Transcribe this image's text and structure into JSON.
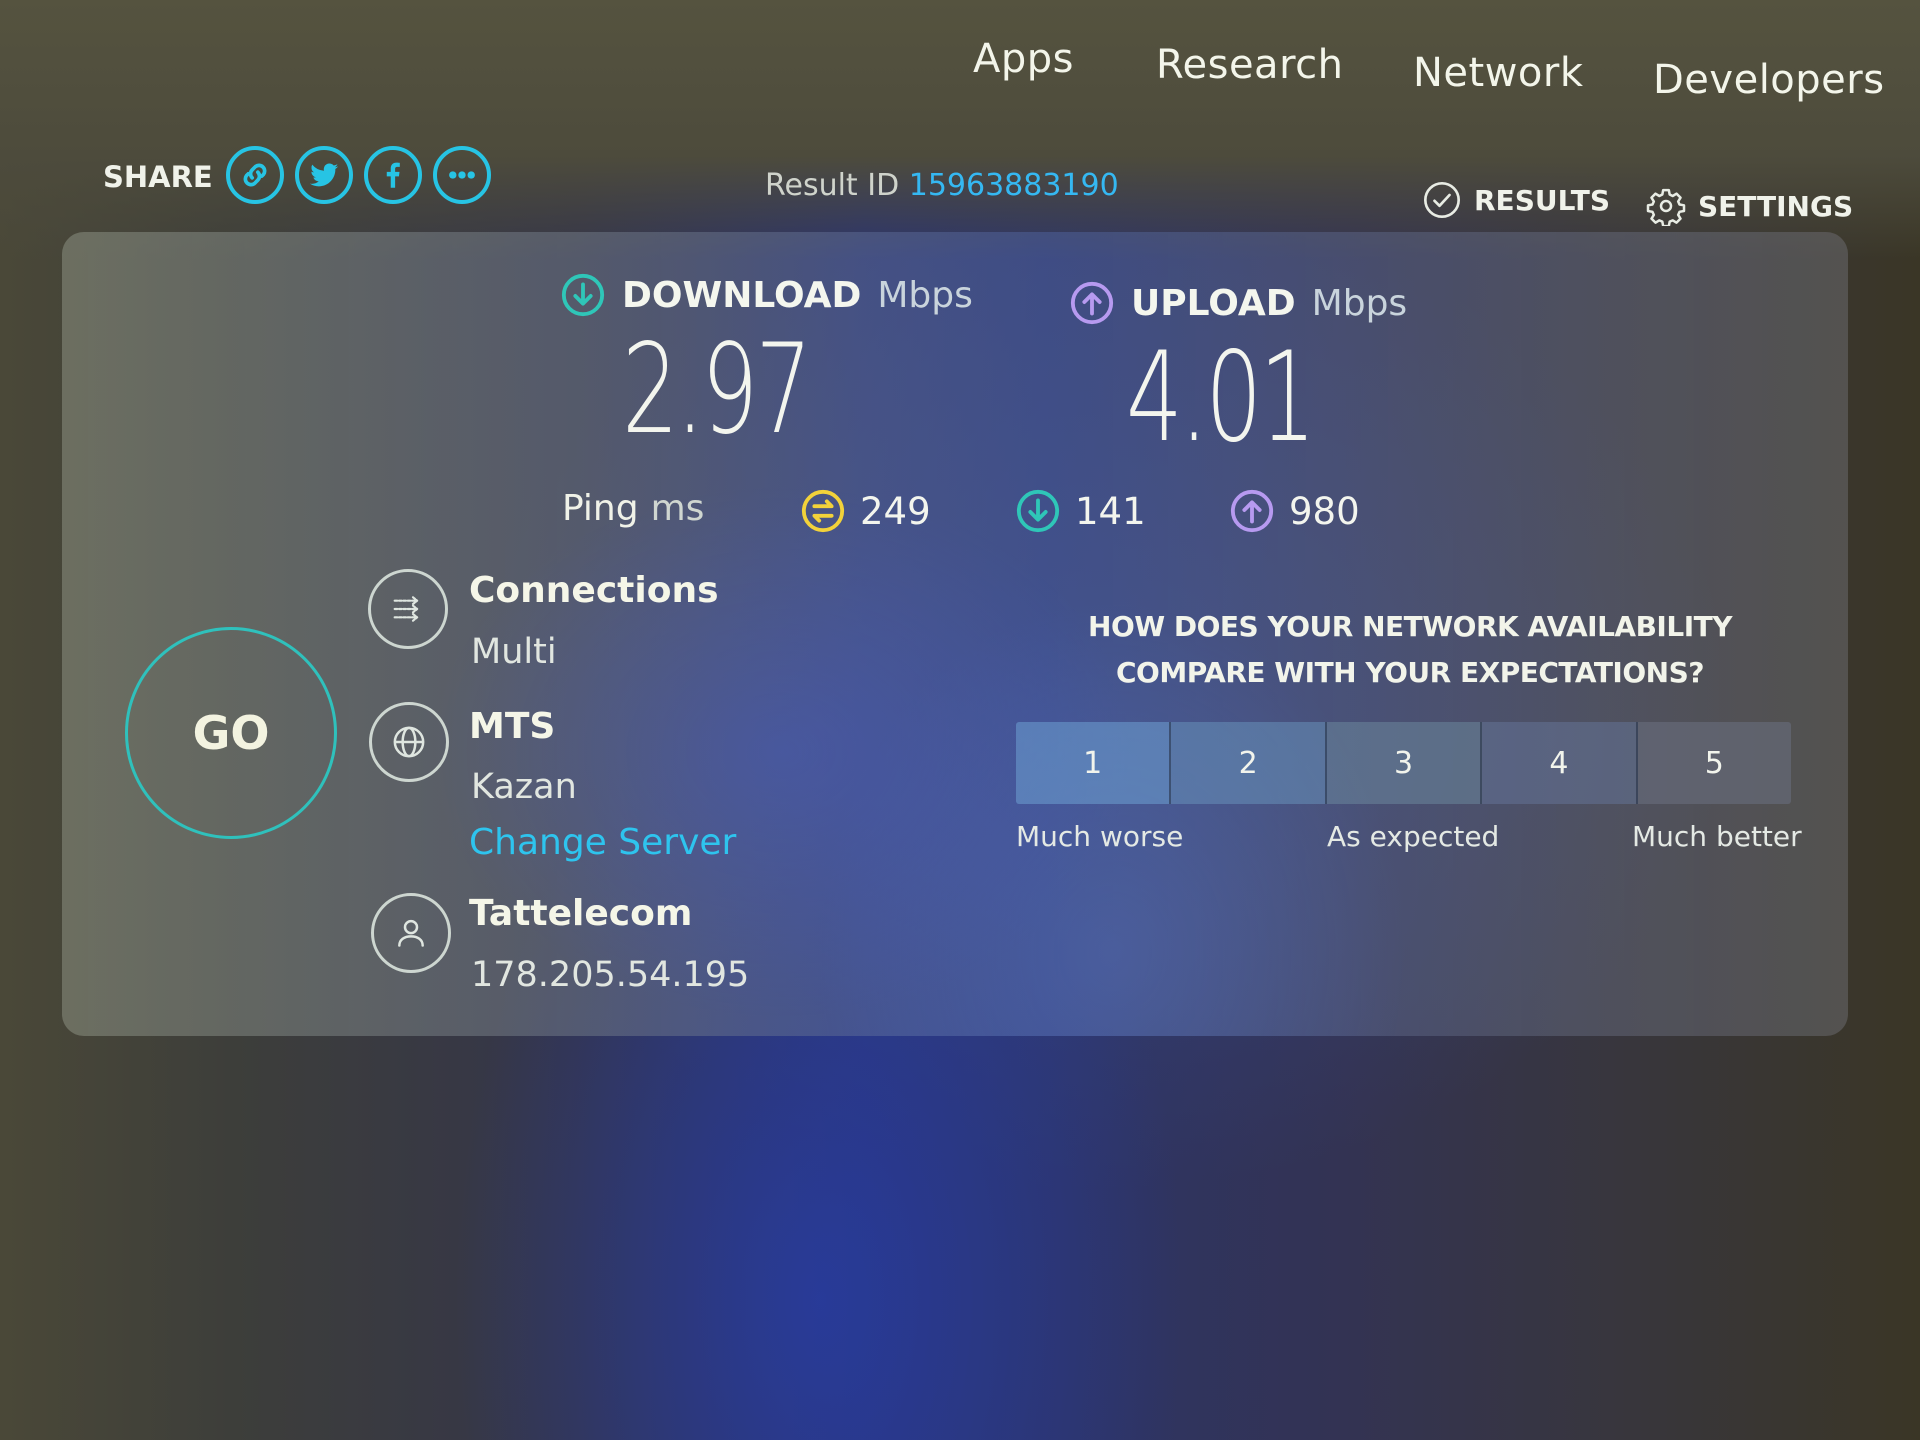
{
  "nav": {
    "items": [
      {
        "label": "Apps"
      },
      {
        "label": "Research"
      },
      {
        "label": "Network"
      },
      {
        "label": "Developers"
      }
    ]
  },
  "share": {
    "label": "SHARE",
    "buttons": [
      {
        "icon": "link-icon"
      },
      {
        "icon": "twitter-icon"
      },
      {
        "icon": "facebook-icon"
      },
      {
        "icon": "more-icon"
      }
    ]
  },
  "result": {
    "label": "Result ID",
    "id": "15963883190"
  },
  "header_actions": {
    "results_label": "RESULTS",
    "settings_label": "SETTINGS"
  },
  "download": {
    "label": "DOWNLOAD",
    "unit": "Mbps",
    "value": "2.97",
    "color": "#2fc6b8"
  },
  "upload": {
    "label": "UPLOAD",
    "unit": "Mbps",
    "value": "4.01",
    "color": "#b79af0"
  },
  "ping": {
    "label": "Ping",
    "unit": "ms",
    "idle": {
      "value": "249",
      "color": "#f2d23a"
    },
    "download": {
      "value": "141",
      "color": "#2fc6b8"
    },
    "upload": {
      "value": "980",
      "color": "#b79af0"
    }
  },
  "go_button": {
    "label": "GO",
    "color": "#2fc1bc"
  },
  "connections": {
    "title": "Connections",
    "value": "Multi"
  },
  "server": {
    "name": "MTS",
    "location": "Kazan",
    "change_label": "Change Server"
  },
  "provider": {
    "name": "Tattelecom",
    "ip": "178.205.54.195"
  },
  "survey": {
    "question_line1": "HOW DOES YOUR NETWORK AVAILABILITY",
    "question_line2": "COMPARE WITH YOUR EXPECTATIONS?",
    "options": [
      "1",
      "2",
      "3",
      "4",
      "5"
    ],
    "label_low": "Much worse",
    "label_mid": "As expected",
    "label_high": "Much better"
  },
  "colors": {
    "accent": "#27c4e4",
    "link": "#35b8f2"
  }
}
